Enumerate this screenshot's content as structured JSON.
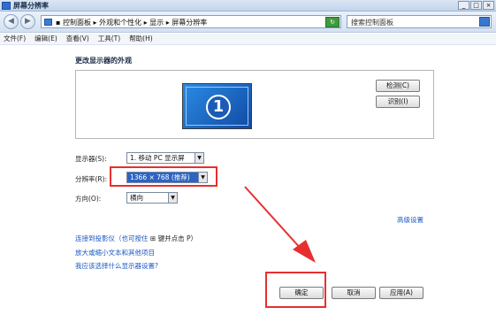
{
  "window": {
    "title": "屏幕分辨率",
    "controls": [
      "_",
      "□",
      "×"
    ]
  },
  "address": {
    "path": "▪ 控制面板 ▸ 外观和个性化 ▸ 显示 ▸ 屏幕分辨率",
    "search_placeholder": "搜索控制面板"
  },
  "menu": [
    "文件(F)",
    "编辑(E)",
    "查看(V)",
    "工具(T)",
    "帮助(H)"
  ],
  "main": {
    "heading": "更改显示器的外观",
    "monitor_number": "1",
    "detect_label": "检测(C)",
    "identify_label": "识别(I)"
  },
  "fields": {
    "display_label": "显示器(S):",
    "display_value": "1. 移动 PC 显示屏",
    "resolution_label": "分辨率(R):",
    "resolution_value": "1366 × 768 (推荐)",
    "orientation_label": "方向(O):",
    "orientation_value": "横向"
  },
  "advanced_link": "高级设置",
  "links": {
    "projector_text": "连接到投影仪（也可按住",
    "projector_key": "键并点击 P）",
    "text_size": "放大或缩小文本和其他项目",
    "which_settings": "我应该选择什么显示器设置?"
  },
  "footer": {
    "ok": "确定",
    "cancel": "取消",
    "apply": "应用(A)"
  },
  "colors": {
    "highlight": "#e63030",
    "link": "#1a57c2"
  }
}
